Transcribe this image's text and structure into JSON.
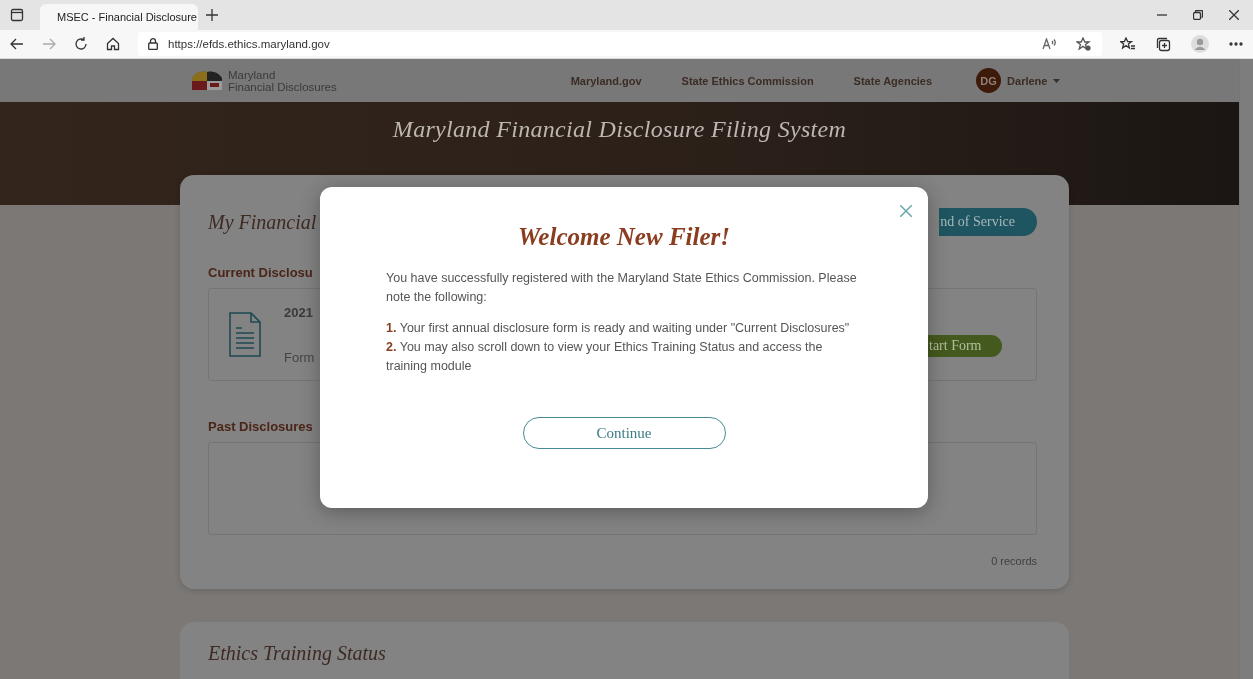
{
  "browser": {
    "tab_title": "MSEC - Financial Disclosure",
    "url": "https://efds.ethics.maryland.gov"
  },
  "site_nav": {
    "logo_line_1": "Maryland",
    "logo_line_2": "Financial Disclosures",
    "links": [
      "Maryland.gov",
      "State Ethics Commission",
      "State Agencies"
    ],
    "user_initials": "DG",
    "user_name": "Darlene"
  },
  "hero": {
    "title": "Maryland Financial Disclosure Filing System"
  },
  "disclosures_card": {
    "title": "My Financial",
    "action_button": "nd of Service",
    "current_heading": "Current Disclosu",
    "current_item": {
      "year": "2021",
      "form": "Form",
      "button": "tart Form"
    },
    "past_heading": "Past Disclosures",
    "records": "0 records"
  },
  "training_card": {
    "title": "Ethics Training Status"
  },
  "modal": {
    "title": "Welcome New Filer!",
    "intro": "You have successfully registered with the Maryland State Ethics Commission. Please note the following:",
    "items": [
      "**1.** Your first annual disclosure form is ready and waiting under \"Current Disclosures\"",
      "**2.** You may also scroll down to view your Ethics Training Status and access the training module"
    ],
    "button": "Continue"
  }
}
